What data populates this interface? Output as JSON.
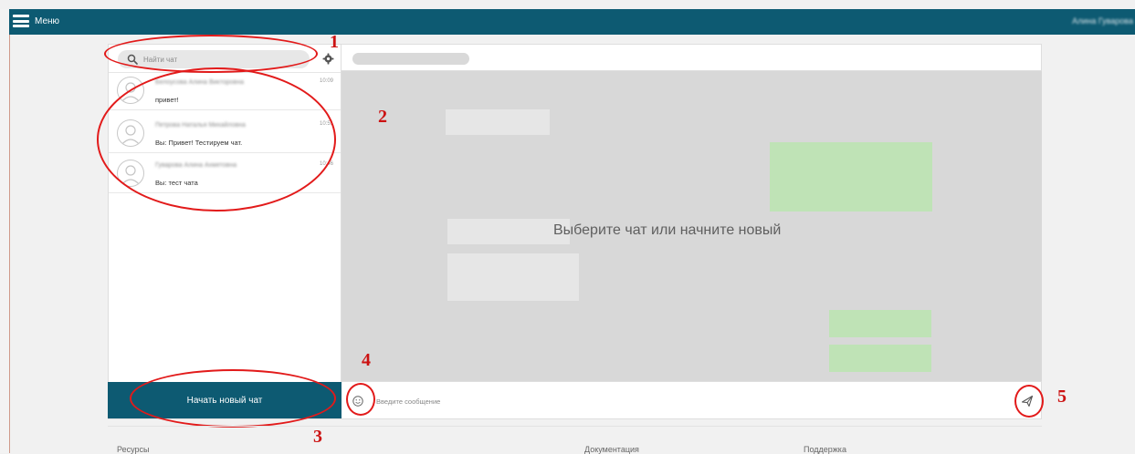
{
  "topbar": {
    "menu_label": "Меню",
    "user_name": "Алина Гуварова"
  },
  "search": {
    "placeholder": "Найти чат"
  },
  "chats": [
    {
      "name": "Белоусова Алина Викторовна",
      "time": "10:09",
      "preview": "привет!"
    },
    {
      "name": "Петрова Наталья Михайловна",
      "time": "10:51",
      "preview": "Вы:  Привет! Тестируем чат."
    },
    {
      "name": "Гуварова Алина Ахметовна",
      "time": "10:46",
      "preview": "Вы:  тест чата"
    }
  ],
  "new_chat_button": "Начать новый чат",
  "empty_state": "Выберите чат или начните новый",
  "composer": {
    "placeholder": "Введите сообщение"
  },
  "annotations": [
    "1",
    "2",
    "3",
    "4",
    "5"
  ],
  "footer": {
    "links": [
      "Ресурсы",
      "Документация",
      "Поддержка"
    ]
  },
  "icons": {
    "menu": "hamburger-icon",
    "search": "search-icon",
    "settings": "gear-icon",
    "avatar": "user-avatar-icon",
    "emoji": "emoji-icon",
    "send": "send-icon"
  },
  "colors": {
    "brand": "#0d5a72",
    "annotation": "#e21a1a",
    "bubble_out": "#bfe3b6",
    "bubble_in": "#e6e6e6",
    "chat_background": "#d8d8d8"
  }
}
